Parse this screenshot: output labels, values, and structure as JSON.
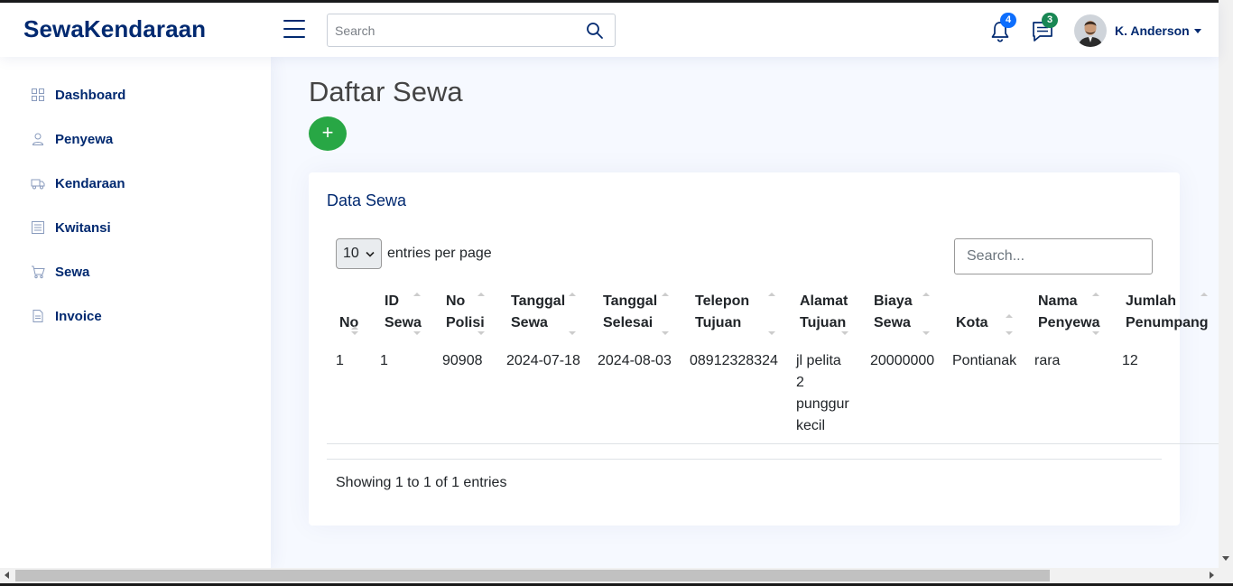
{
  "brand": {
    "logo": "SewaKendaraan",
    "accent": "#012970"
  },
  "header": {
    "search_placeholder": "Search",
    "notifications_count": "4",
    "messages_count": "3",
    "user_name": "K. Anderson"
  },
  "sidebar": {
    "items": [
      {
        "label": "Dashboard",
        "icon": "grid-icon"
      },
      {
        "label": "Penyewa",
        "icon": "person-icon"
      },
      {
        "label": "Kendaraan",
        "icon": "truck-icon"
      },
      {
        "label": "Kwitansi",
        "icon": "receipt-icon"
      },
      {
        "label": "Sewa",
        "icon": "cart-icon"
      },
      {
        "label": "Invoice",
        "icon": "file-icon"
      }
    ]
  },
  "main": {
    "page_title": "Daftar Sewa",
    "add_label": "+",
    "card_title": "Data Sewa",
    "per_page_value": "10",
    "per_page_label": "entries per page",
    "table_search_placeholder": "Search...",
    "columns": [
      {
        "line1": "",
        "line2": "No"
      },
      {
        "line1": "ID",
        "line2": "Sewa"
      },
      {
        "line1": "No",
        "line2": "Polisi"
      },
      {
        "line1": "Tanggal",
        "line2": "Sewa"
      },
      {
        "line1": "Tanggal",
        "line2": "Selesai"
      },
      {
        "line1": "Telepon",
        "line2": "Tujuan"
      },
      {
        "line1": "Alamat",
        "line2": "Tujuan"
      },
      {
        "line1": "Biaya",
        "line2": "Sewa"
      },
      {
        "line1": "",
        "line2": "Kota"
      },
      {
        "line1": "Nama",
        "line2": "Penyewa"
      },
      {
        "line1": "Jumlah",
        "line2": "Penumpang"
      }
    ],
    "rows": [
      {
        "no": "1",
        "id_sewa": "1",
        "no_polisi": "90908",
        "tanggal_sewa": "2024-07-18",
        "tanggal_selesai": "2024-08-03",
        "telepon_tujuan": "08912328324",
        "alamat_lines": [
          "jl pelita",
          "2",
          "punggur",
          "kecil"
        ],
        "biaya_sewa": "20000000",
        "kota": "Pontianak",
        "nama_penyewa": "rara",
        "jumlah_penumpang": "12"
      }
    ],
    "info": "Showing 1 to 1 of 1 entries"
  }
}
